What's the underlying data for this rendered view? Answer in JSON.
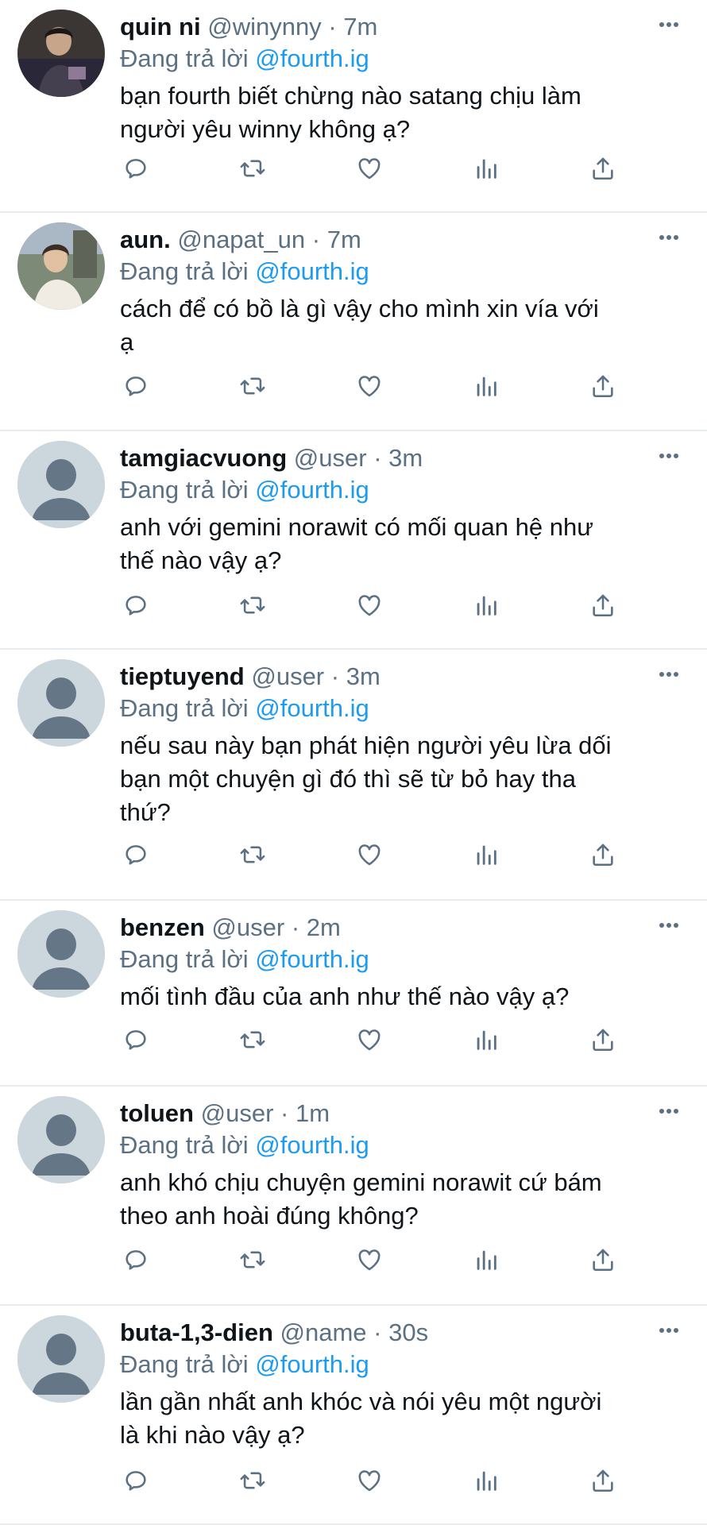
{
  "replying_label": "Đang trả lời",
  "reply_to": "@fourth.ig",
  "separator": "·",
  "colors": {
    "link": "#1d9bf0",
    "secondary": "#5b7083",
    "divider": "#e6ecf0",
    "avatar_default": "#ccd6dd"
  },
  "action_icons": [
    "reply-icon",
    "retweet-icon",
    "like-icon",
    "analytics-icon",
    "share-icon"
  ],
  "tweets": [
    {
      "name": "quin ni",
      "handle": "@winynny",
      "time": "7m",
      "text_lines": [
        "bạn fourth biết chừng nào satang chịu làm",
        "người yêu winny không ạ?"
      ],
      "avatar": "photo"
    },
    {
      "name": "aun.",
      "handle": "@napat_un",
      "time": "7m",
      "text_lines": [
        "cách để có bồ là gì vậy cho mình xin vía với",
        "ạ"
      ],
      "avatar": "photo"
    },
    {
      "name": "tamgiacvuong",
      "handle": "@user",
      "time": "3m",
      "text_lines": [
        "anh với gemini norawit có mối quan hệ như",
        "thế nào vậy ạ?"
      ],
      "avatar": "default"
    },
    {
      "name": "tieptuyend",
      "handle": "@user",
      "time": "3m",
      "text_lines": [
        "nếu sau này bạn phát hiện người yêu lừa dối",
        "bạn một chuyện gì đó thì sẽ từ bỏ hay tha",
        "thứ?"
      ],
      "avatar": "default"
    },
    {
      "name": "benzen",
      "handle": "@user",
      "time": "2m",
      "text_lines": [
        "mối tình đầu của anh như thế nào vậy ạ?"
      ],
      "avatar": "default"
    },
    {
      "name": "toluen",
      "handle": "@user",
      "time": "1m",
      "text_lines": [
        "anh khó chịu chuyện gemini norawit cứ bám",
        "theo anh hoài đúng không?"
      ],
      "avatar": "default"
    },
    {
      "name": "buta-1,3-dien",
      "handle": "@name",
      "time": "30s",
      "text_lines": [
        "lần gần nhất anh khóc và nói yêu một người",
        "là khi nào vậy ạ?"
      ],
      "avatar": "default"
    }
  ]
}
